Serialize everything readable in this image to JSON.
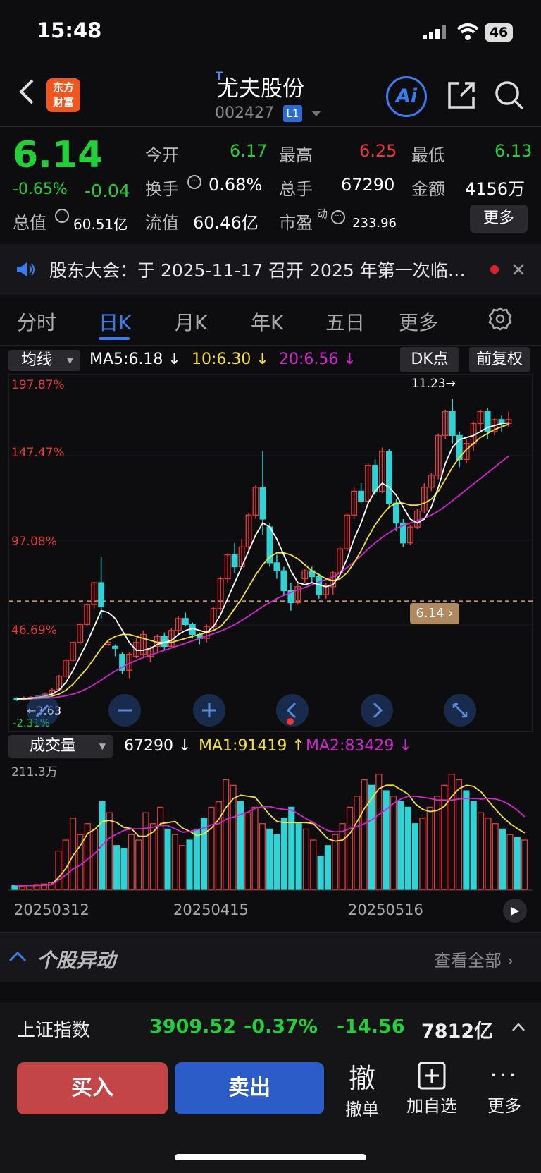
{
  "status": {
    "time": "15:48",
    "battery": "46"
  },
  "header": {
    "back_icon": "chevron-left-icon",
    "logo": "东方\n财富",
    "t_mark": "T",
    "name": "尤夫股份",
    "code": "002427",
    "level": "L1",
    "ai": "Ai"
  },
  "quote": {
    "price": "6.14",
    "pct": "-0.65%",
    "change": "-0.04",
    "open_l": "今开",
    "open": "6.17",
    "high_l": "最高",
    "high": "6.25",
    "low_l": "最低",
    "low": "6.13",
    "turnover_l": "换手",
    "turnover": "0.68%",
    "vol_l": "总手",
    "vol": "67290",
    "amount_l": "金额",
    "amount": "4156万",
    "mcap_l": "总值",
    "mcap": "60.51亿",
    "float_l": "流值",
    "float": "60.46亿",
    "pe_l": "市盈",
    "pe_sup": "动",
    "pe": "233.96",
    "more": "更多"
  },
  "notice": {
    "text": "股东大会：于 2025-11-17 召开 2025 年第一次临…"
  },
  "tabs": [
    "分时",
    "日K",
    "月K",
    "年K",
    "五日",
    "更多"
  ],
  "chart_header": {
    "ma_select": "均线",
    "ma5": "MA5:6.18",
    "ma10": "10:6.30",
    "ma20": "20:6.56",
    "dk": "DK点",
    "fq": "前复权"
  },
  "chart_labels": {
    "p1": "197.87%",
    "p2": "147.47%",
    "p3": "97.08%",
    "p4": "46.69%",
    "high_mark": "11.23",
    "low_mark": "3.63",
    "low_pct": "-2.31%",
    "cur_price": "6.14"
  },
  "vol_header": {
    "select": "成交量",
    "vol": "67290",
    "ma1": "MA1:91419",
    "ma2": "MA2:83429"
  },
  "vol_labels": {
    "max": "211.3万",
    "d1": "20250312",
    "d2": "20250415",
    "d3": "20250516"
  },
  "colors": {
    "up": "#e5393b",
    "down": "#2fd3d6",
    "ma5": "#ffffff",
    "ma10": "#f5e033",
    "ma20": "#d424d0"
  },
  "section": {
    "title": "个股异动",
    "link": "查看全部"
  },
  "index": {
    "name": "上证指数",
    "value": "3909.52",
    "pct": "-0.37%",
    "change": "-14.56",
    "amount": "7812亿"
  },
  "actions": {
    "buy": "买入",
    "sell": "卖出",
    "cancel_glyph": "撤",
    "cancel": "撤单",
    "add": "加自选",
    "more": "更多"
  },
  "chart_data": {
    "type": "candlestick",
    "candles": [
      {
        "o": 3.7,
        "c": 3.66,
        "h": 3.72,
        "l": 3.63
      },
      {
        "o": 3.68,
        "c": 3.7,
        "h": 3.74,
        "l": 3.64
      },
      {
        "o": 3.7,
        "c": 3.72,
        "h": 3.75,
        "l": 3.66
      },
      {
        "o": 3.72,
        "c": 3.75,
        "h": 3.78,
        "l": 3.68
      },
      {
        "o": 3.75,
        "c": 3.8,
        "h": 3.84,
        "l": 3.72
      },
      {
        "o": 3.8,
        "c": 3.9,
        "h": 3.95,
        "l": 3.78
      },
      {
        "o": 3.92,
        "c": 4.25,
        "h": 4.28,
        "l": 3.9
      },
      {
        "o": 4.25,
        "c": 4.65,
        "h": 4.68,
        "l": 4.22
      },
      {
        "o": 4.65,
        "c": 5.1,
        "h": 5.12,
        "l": 4.6
      },
      {
        "o": 5.1,
        "c": 5.55,
        "h": 5.58,
        "l": 5.05
      },
      {
        "o": 5.55,
        "c": 6.05,
        "h": 6.08,
        "l": 5.5
      },
      {
        "o": 6.05,
        "c": 6.6,
        "h": 6.62,
        "l": 5.95
      },
      {
        "o": 6.6,
        "c": 6.0,
        "h": 7.25,
        "l": 5.7
      },
      {
        "o": 5.05,
        "c": 5.1,
        "h": 5.15,
        "l": 5.0
      },
      {
        "o": 5.0,
        "c": 4.95,
        "h": 5.05,
        "l": 4.75
      },
      {
        "o": 4.8,
        "c": 4.4,
        "h": 4.85,
        "l": 4.3
      },
      {
        "o": 4.4,
        "c": 4.8,
        "h": 4.85,
        "l": 4.2
      },
      {
        "o": 4.75,
        "c": 5.1,
        "h": 5.2,
        "l": 4.7
      },
      {
        "o": 4.8,
        "c": 5.3,
        "h": 5.4,
        "l": 4.7
      },
      {
        "o": 4.75,
        "c": 4.95,
        "h": 5.0,
        "l": 4.6
      },
      {
        "o": 5.0,
        "c": 5.25,
        "h": 5.3,
        "l": 4.85
      },
      {
        "o": 5.25,
        "c": 5.0,
        "h": 5.35,
        "l": 4.9
      },
      {
        "o": 5.0,
        "c": 5.4,
        "h": 5.45,
        "l": 4.95
      },
      {
        "o": 5.4,
        "c": 5.7,
        "h": 5.75,
        "l": 5.3
      },
      {
        "o": 5.7,
        "c": 5.55,
        "h": 5.85,
        "l": 5.5
      },
      {
        "o": 5.55,
        "c": 5.3,
        "h": 5.6,
        "l": 5.2
      },
      {
        "o": 5.3,
        "c": 5.2,
        "h": 5.35,
        "l": 5.05
      },
      {
        "o": 5.2,
        "c": 5.5,
        "h": 5.55,
        "l": 5.1
      },
      {
        "o": 5.5,
        "c": 5.95,
        "h": 6.0,
        "l": 5.4
      },
      {
        "o": 5.95,
        "c": 6.7,
        "h": 6.75,
        "l": 5.9
      },
      {
        "o": 6.7,
        "c": 7.3,
        "h": 7.35,
        "l": 6.6
      },
      {
        "o": 7.3,
        "c": 7.0,
        "h": 7.6,
        "l": 6.85
      },
      {
        "o": 7.0,
        "c": 7.5,
        "h": 7.7,
        "l": 6.95
      },
      {
        "o": 7.5,
        "c": 8.3,
        "h": 8.35,
        "l": 7.4
      },
      {
        "o": 8.3,
        "c": 9.0,
        "h": 9.05,
        "l": 8.2
      },
      {
        "o": 9.0,
        "c": 8.2,
        "h": 9.9,
        "l": 7.8
      },
      {
        "o": 8.0,
        "c": 7.1,
        "h": 8.1,
        "l": 7.0
      },
      {
        "o": 7.1,
        "c": 6.9,
        "h": 7.3,
        "l": 6.7
      },
      {
        "o": 6.9,
        "c": 6.4,
        "h": 7.0,
        "l": 6.3
      },
      {
        "o": 6.4,
        "c": 6.1,
        "h": 6.6,
        "l": 5.9
      },
      {
        "o": 6.1,
        "c": 6.5,
        "h": 6.6,
        "l": 6.05
      },
      {
        "o": 6.7,
        "c": 6.9,
        "h": 6.95,
        "l": 6.6
      },
      {
        "o": 6.9,
        "c": 6.75,
        "h": 7.0,
        "l": 6.6
      },
      {
        "o": 6.75,
        "c": 6.3,
        "h": 6.85,
        "l": 6.2
      },
      {
        "o": 6.3,
        "c": 6.5,
        "h": 6.6,
        "l": 6.2
      },
      {
        "o": 6.5,
        "c": 6.85,
        "h": 6.9,
        "l": 6.3
      },
      {
        "o": 6.85,
        "c": 7.45,
        "h": 7.5,
        "l": 6.8
      },
      {
        "o": 7.45,
        "c": 8.3,
        "h": 8.35,
        "l": 7.4
      },
      {
        "o": 8.3,
        "c": 8.9,
        "h": 9.0,
        "l": 8.2
      },
      {
        "o": 8.9,
        "c": 8.65,
        "h": 9.1,
        "l": 8.6
      },
      {
        "o": 8.65,
        "c": 9.55,
        "h": 9.6,
        "l": 8.6
      },
      {
        "o": 9.55,
        "c": 8.9,
        "h": 9.7,
        "l": 8.8
      },
      {
        "o": 8.9,
        "c": 9.9,
        "h": 10.0,
        "l": 8.85
      },
      {
        "o": 9.9,
        "c": 8.6,
        "h": 9.95,
        "l": 8.5
      },
      {
        "o": 8.6,
        "c": 8.1,
        "h": 8.7,
        "l": 7.9
      },
      {
        "o": 8.1,
        "c": 7.6,
        "h": 8.2,
        "l": 7.5
      },
      {
        "o": 7.6,
        "c": 8.0,
        "h": 8.05,
        "l": 7.55
      },
      {
        "o": 8.0,
        "c": 8.4,
        "h": 8.45,
        "l": 7.95
      },
      {
        "o": 8.4,
        "c": 9.0,
        "h": 9.1,
        "l": 8.35
      },
      {
        "o": 9.0,
        "c": 9.3,
        "h": 9.35,
        "l": 8.9
      },
      {
        "o": 9.3,
        "c": 10.3,
        "h": 10.35,
        "l": 9.2
      },
      {
        "o": 10.3,
        "c": 10.9,
        "h": 10.95,
        "l": 10.2
      },
      {
        "o": 10.9,
        "c": 10.3,
        "h": 11.23,
        "l": 10.1
      },
      {
        "o": 10.3,
        "c": 9.7,
        "h": 10.4,
        "l": 9.5
      },
      {
        "o": 9.7,
        "c": 10.1,
        "h": 10.2,
        "l": 9.6
      },
      {
        "o": 10.1,
        "c": 10.6,
        "h": 10.65,
        "l": 9.9
      },
      {
        "o": 10.6,
        "c": 10.9,
        "h": 10.95,
        "l": 10.4
      },
      {
        "o": 10.9,
        "c": 10.4,
        "h": 11.0,
        "l": 10.2
      },
      {
        "o": 10.4,
        "c": 10.7,
        "h": 10.75,
        "l": 10.3
      },
      {
        "o": 10.7,
        "c": 10.6,
        "h": 10.8,
        "l": 10.4
      },
      {
        "o": 10.6,
        "c": 10.7,
        "h": 10.9,
        "l": 10.5
      }
    ],
    "volumes": [
      8,
      6,
      7,
      9,
      10,
      12,
      70,
      90,
      130,
      100,
      120,
      110,
      160,
      140,
      80,
      75,
      100,
      90,
      140,
      120,
      150,
      110,
      100,
      80,
      90,
      110,
      130,
      150,
      160,
      200,
      190,
      160,
      140,
      150,
      120,
      110,
      100,
      130,
      150,
      120,
      110,
      90,
      60,
      80,
      100,
      120,
      150,
      170,
      200,
      190,
      210,
      180,
      170,
      160,
      150,
      120,
      130,
      150,
      170,
      190,
      210,
      200,
      180,
      160,
      140,
      130,
      120,
      110,
      100,
      95,
      90
    ],
    "ma5": [
      3.68,
      3.69,
      3.7,
      3.72,
      3.75,
      3.8,
      3.9,
      4.1,
      4.4,
      4.75,
      5.1,
      5.5,
      5.9,
      5.85,
      5.7,
      5.4,
      5.1,
      4.9,
      4.9,
      4.95,
      5.05,
      5.1,
      5.15,
      5.3,
      5.4,
      5.45,
      5.4,
      5.35,
      5.5,
      5.8,
      6.2,
      6.6,
      7.0,
      7.4,
      7.8,
      8.1,
      8.0,
      7.7,
      7.3,
      6.9,
      6.6,
      6.55,
      6.6,
      6.55,
      6.5,
      6.55,
      6.8,
      7.2,
      7.7,
      8.1,
      8.6,
      8.9,
      9.1,
      9.0,
      8.8,
      8.5,
      8.2,
      8.1,
      8.2,
      8.5,
      9.0,
      9.6,
      10.0,
      10.2,
      10.25,
      10.3,
      10.4,
      10.5,
      10.55,
      10.6,
      10.62
    ],
    "ma10": [
      3.68,
      3.68,
      3.69,
      3.7,
      3.72,
      3.75,
      3.8,
      3.9,
      4.05,
      4.25,
      4.45,
      4.7,
      4.95,
      5.15,
      5.25,
      5.3,
      5.3,
      5.25,
      5.2,
      5.15,
      5.1,
      5.1,
      5.1,
      5.15,
      5.2,
      5.25,
      5.3,
      5.35,
      5.4,
      5.5,
      5.7,
      5.95,
      6.2,
      6.5,
      6.8,
      7.05,
      7.25,
      7.35,
      7.35,
      7.3,
      7.2,
      7.05,
      6.9,
      6.8,
      6.7,
      6.65,
      6.7,
      6.85,
      7.1,
      7.4,
      7.75,
      8.05,
      8.3,
      8.5,
      8.6,
      8.6,
      8.55,
      8.55,
      8.6,
      8.7,
      8.9,
      9.2,
      9.5,
      9.75,
      9.95,
      10.1,
      10.25,
      10.35,
      10.45,
      10.52,
      10.58
    ],
    "ma20": [
      3.68,
      3.68,
      3.68,
      3.69,
      3.7,
      3.71,
      3.73,
      3.76,
      3.8,
      3.86,
      3.94,
      4.04,
      4.15,
      4.27,
      4.38,
      4.48,
      4.57,
      4.65,
      4.72,
      4.78,
      4.84,
      4.9,
      4.96,
      5.02,
      5.08,
      5.14,
      5.2,
      5.26,
      5.32,
      5.38,
      5.46,
      5.55,
      5.65,
      5.76,
      5.88,
      6.0,
      6.1,
      6.2,
      6.28,
      6.35,
      6.42,
      6.48,
      6.55,
      6.62,
      6.68,
      6.75,
      6.85,
      6.98,
      7.12,
      7.28,
      7.45,
      7.6,
      7.74,
      7.86,
      7.96,
      8.04,
      8.1,
      8.16,
      8.22,
      8.3,
      8.4,
      8.52,
      8.66,
      8.8,
      8.94,
      9.08,
      9.22,
      9.36,
      9.5,
      9.64,
      9.78
    ]
  }
}
